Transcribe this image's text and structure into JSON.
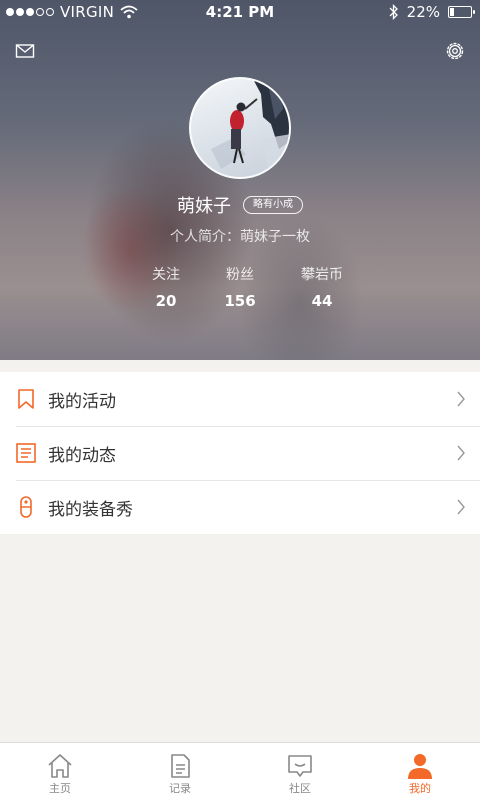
{
  "status_bar": {
    "carrier": "VIRGIN",
    "time": "4:21 PM",
    "battery": "22%",
    "battery_level": 0.22,
    "signal_bars_filled": 3,
    "signal_bars_total": 5
  },
  "header": {
    "left_icon": "mail-icon",
    "right_icon": "gear-icon"
  },
  "profile": {
    "username": "萌妹子",
    "badge": "略有小成",
    "bio": "个人简介：萌妹子一枚",
    "stats": [
      {
        "label": "关注",
        "value": "20"
      },
      {
        "label": "粉丝",
        "value": "156"
      },
      {
        "label": "攀岩币",
        "value": "44"
      }
    ]
  },
  "menu": {
    "items": [
      {
        "label": "我的活动",
        "icon": "bookmark-icon"
      },
      {
        "label": "我的动态",
        "icon": "document-list-icon"
      },
      {
        "label": "我的装备秀",
        "icon": "carabiner-icon"
      }
    ]
  },
  "tabbar": {
    "tabs": [
      {
        "label": "主页",
        "icon": "home-icon",
        "active": false
      },
      {
        "label": "记录",
        "icon": "record-icon",
        "active": false
      },
      {
        "label": "社区",
        "icon": "community-icon",
        "active": false
      },
      {
        "label": "我的",
        "icon": "person-icon",
        "active": true
      }
    ]
  },
  "colors": {
    "accent": "#f2692a",
    "text": "#333333",
    "inactive": "#888888",
    "background": "#f3f2ef"
  }
}
